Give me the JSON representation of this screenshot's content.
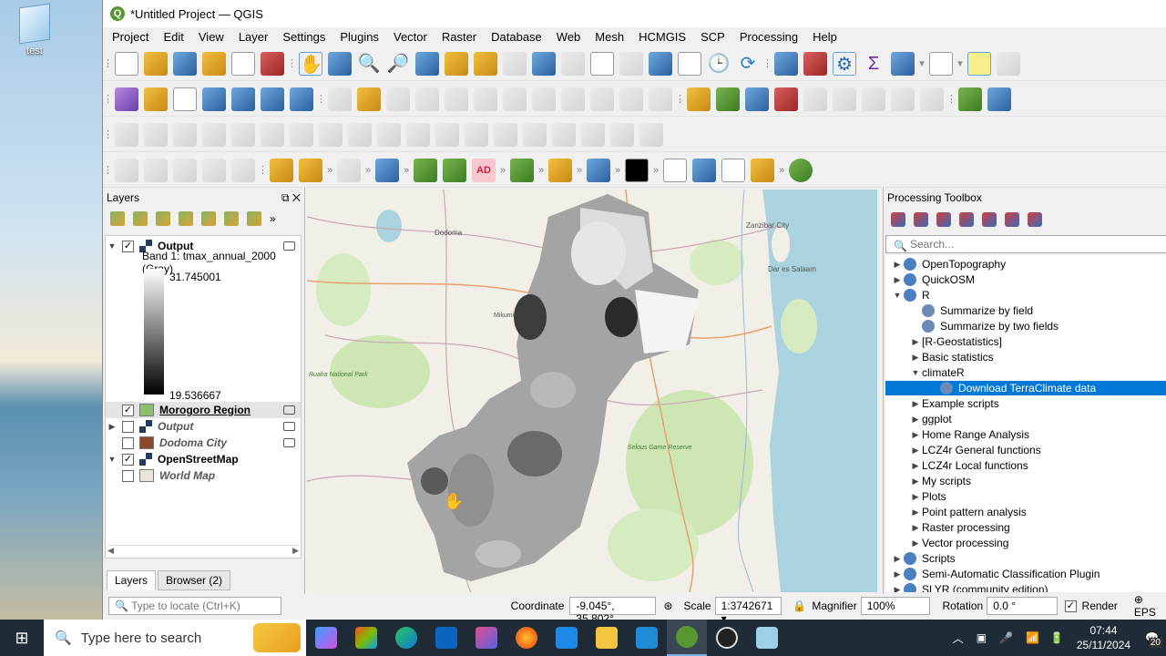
{
  "desktop": {
    "icon_label": "test"
  },
  "window": {
    "title": "*Untitled Project — QGIS"
  },
  "menu": [
    "Project",
    "Edit",
    "View",
    "Layer",
    "Settings",
    "Plugins",
    "Vector",
    "Raster",
    "Database",
    "Web",
    "Mesh",
    "HCMGIS",
    "SCP",
    "Processing",
    "Help"
  ],
  "layers_panel": {
    "title": "Layers",
    "band_label": "Band 1: tmax_annual_2000 (Gray)",
    "ramp_max": "31.745001",
    "ramp_min": "19.536667",
    "items": [
      {
        "name": "Output",
        "checked": true,
        "expanded": true
      },
      {
        "name": "Morogoro Region",
        "checked": true,
        "color": "#8fbf6e"
      },
      {
        "name": "Output",
        "checked": false
      },
      {
        "name": "Dodoma City",
        "checked": false,
        "color": "#8b4a2a"
      },
      {
        "name": "OpenStreetMap",
        "checked": true
      },
      {
        "name": "World Map",
        "checked": false
      }
    ],
    "tabs": [
      "Layers",
      "Browser (2)"
    ]
  },
  "map": {
    "labels": [
      "Dodoma",
      "Zanzibar City",
      "Dar es Salaam",
      "Ruaha National Park",
      "Selous Game Reserve",
      "Mikumi"
    ]
  },
  "toolbox": {
    "title": "Processing Toolbox",
    "search_placeholder": "Search...",
    "items": [
      {
        "label": "OpenTopography",
        "level": 0,
        "arrow": "▶"
      },
      {
        "label": "QuickOSM",
        "level": 0,
        "arrow": "▶"
      },
      {
        "label": "R",
        "level": 0,
        "arrow": "▼"
      },
      {
        "label": "Summarize by field",
        "level": 1,
        "arrow": ""
      },
      {
        "label": "Summarize by two fields",
        "level": 1,
        "arrow": ""
      },
      {
        "label": "[R-Geostatistics]",
        "level": 1,
        "arrow": "▶"
      },
      {
        "label": "Basic statistics",
        "level": 1,
        "arrow": "▶"
      },
      {
        "label": "climateR",
        "level": 1,
        "arrow": "▼"
      },
      {
        "label": "Download TerraClimate data",
        "level": 2,
        "arrow": "",
        "selected": true
      },
      {
        "label": "Example scripts",
        "level": 1,
        "arrow": "▶"
      },
      {
        "label": "ggplot",
        "level": 1,
        "arrow": "▶"
      },
      {
        "label": "Home Range Analysis",
        "level": 1,
        "arrow": "▶"
      },
      {
        "label": "LCZ4r General functions",
        "level": 1,
        "arrow": "▶"
      },
      {
        "label": "LCZ4r Local functions",
        "level": 1,
        "arrow": "▶"
      },
      {
        "label": "My scripts",
        "level": 1,
        "arrow": "▶"
      },
      {
        "label": "Plots",
        "level": 1,
        "arrow": "▶"
      },
      {
        "label": "Point pattern analysis",
        "level": 1,
        "arrow": "▶"
      },
      {
        "label": "Raster processing",
        "level": 1,
        "arrow": "▶"
      },
      {
        "label": "Vector processing",
        "level": 1,
        "arrow": "▶"
      },
      {
        "label": "Scripts",
        "level": 0,
        "arrow": "▶"
      },
      {
        "label": "Semi-Automatic Classification Plugin",
        "level": 0,
        "arrow": "▶"
      },
      {
        "label": "SLYR (community edition)",
        "level": 0,
        "arrow": "▶"
      }
    ]
  },
  "status": {
    "locate_placeholder": "Type to locate (Ctrl+K)",
    "coordinate_label": "Coordinate",
    "coordinate": "-9.045°, 35.802°",
    "scale_label": "Scale",
    "scale": "1:3742671",
    "magnifier_label": "Magnifier",
    "magnifier": "100%",
    "rotation_label": "Rotation",
    "rotation": "0.0 °",
    "render_label": "Render",
    "eps": "EPS"
  },
  "taskbar": {
    "search_placeholder": "Type here to search",
    "time": "07:44",
    "date": "25/11/2024",
    "notifications": "20"
  }
}
